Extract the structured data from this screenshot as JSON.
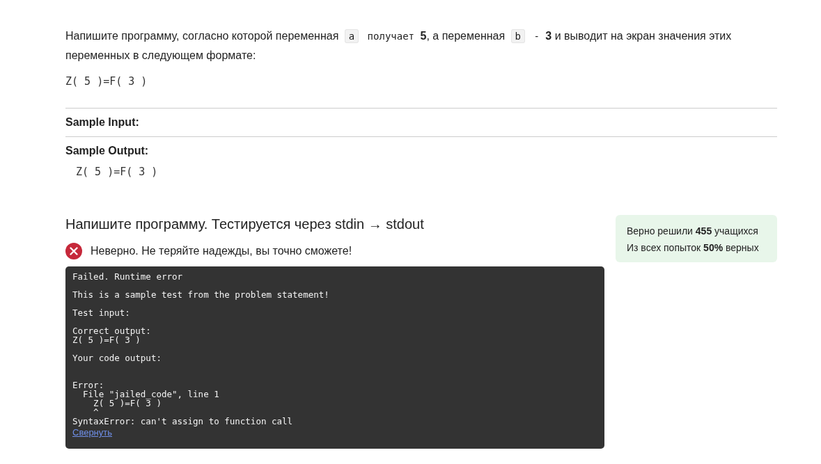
{
  "statement": {
    "parts": [
      {
        "kind": "text",
        "text": "Напишите программу, согласно которой переменная "
      },
      {
        "kind": "code",
        "text": "a"
      },
      {
        "kind": "mono",
        "text": " получает "
      },
      {
        "kind": "bold",
        "text": "5"
      },
      {
        "kind": "text",
        "text": ", а переменная "
      },
      {
        "kind": "code",
        "text": "b"
      },
      {
        "kind": "mono",
        "text": " - "
      },
      {
        "kind": "bold",
        "text": "3"
      },
      {
        "kind": "text",
        "text": " и выводит на экран значения этих переменных в следующем формате:"
      }
    ],
    "format": "Z( 5 )=F( 3 )"
  },
  "sample_input": {
    "label": "Sample Input:"
  },
  "sample_output": {
    "label": "Sample Output:",
    "value": "Z( 5 )=F( 3 )"
  },
  "task": {
    "heading": "Напишите программу. Тестируется через stdin → stdout",
    "verdict": {
      "correct": false,
      "message": "Неверно. Не теряйте надежды, вы точно сможете!"
    },
    "console": {
      "blocks": [
        {
          "kind": "plain",
          "lines": [
            "Failed. Runtime error"
          ]
        },
        {
          "kind": "plain",
          "lines": [
            "This is a sample test from the problem statement!"
          ]
        },
        {
          "kind": "plain",
          "lines": [
            "Test input:"
          ]
        },
        {
          "kind": "plain",
          "lines": [
            "Correct output:",
            "Z( 5 )=F( 3 )"
          ]
        },
        {
          "kind": "plain",
          "lines": [
            "Your code output:"
          ]
        },
        {
          "kind": "error",
          "lines": [
            "Error:",
            "  File \"jailed_code\", line 1",
            "    Z( 5 )=F( 3 )",
            "    ^",
            "SyntaxError: can't assign to function call"
          ]
        }
      ],
      "collapse_link": "Свернуть"
    }
  },
  "stats": {
    "lines": [
      "Верно решили **455** учащихся",
      "Из всех попыток **50%** верных"
    ]
  }
}
